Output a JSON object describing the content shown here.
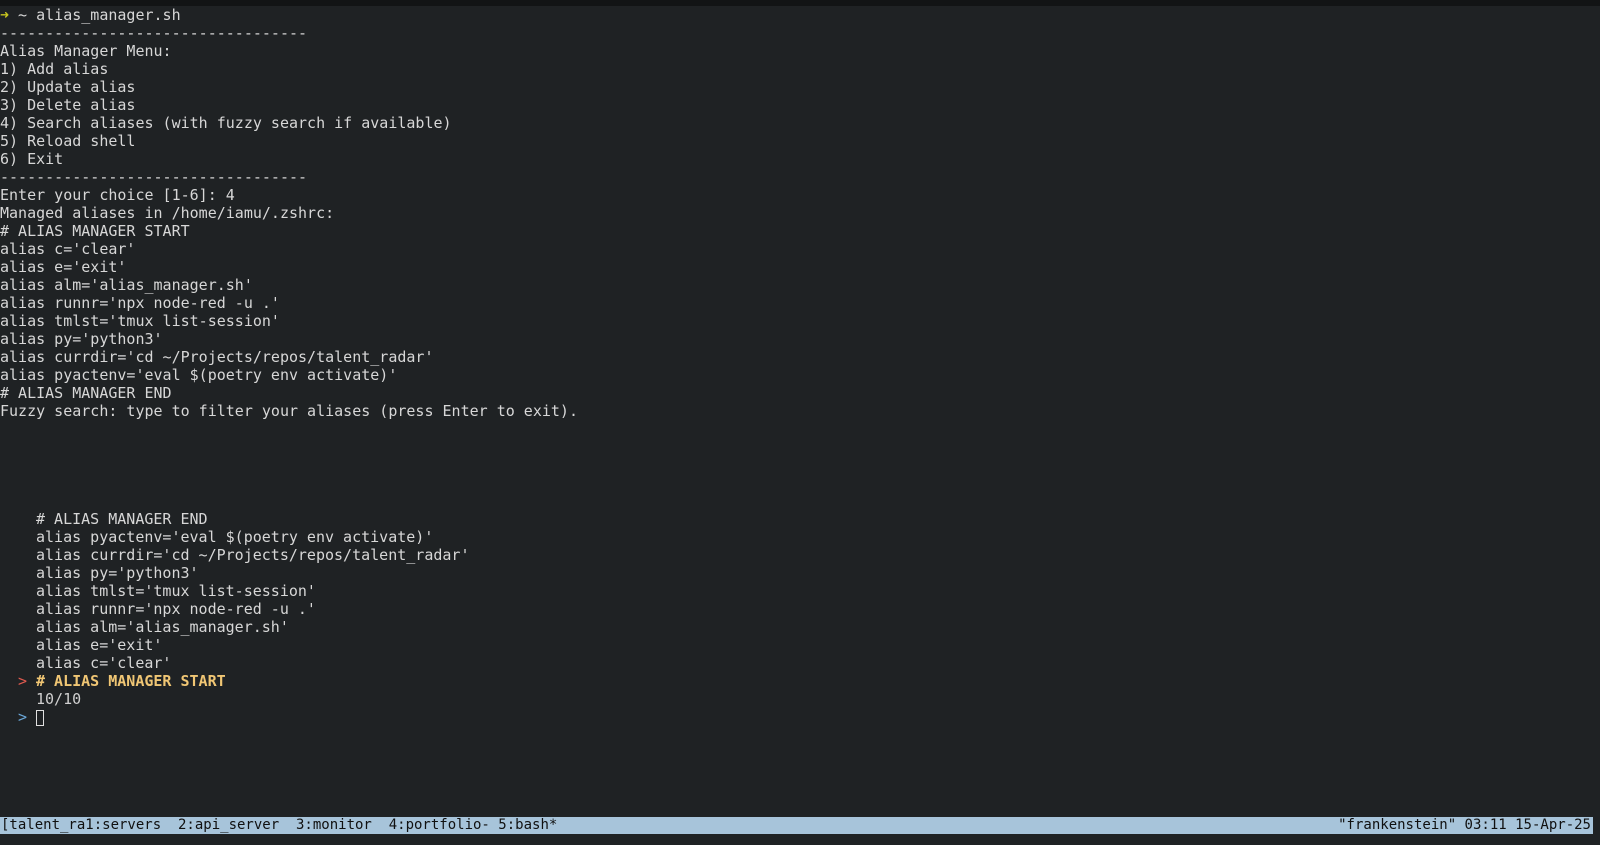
{
  "prompt": {
    "arrow": "➜",
    "command": " ~ alias_manager.sh"
  },
  "output_lines": [
    "----------------------------------",
    "Alias Manager Menu:",
    "1) Add alias",
    "2) Update alias",
    "3) Delete alias",
    "4) Search aliases (with fuzzy search if available)",
    "5) Reload shell",
    "6) Exit",
    "----------------------------------",
    "Enter your choice [1-6]: 4",
    "Managed aliases in /home/iamu/.zshrc:",
    "# ALIAS MANAGER START",
    "alias c='clear'",
    "alias e='exit'",
    "alias alm='alias_manager.sh'",
    "alias runnr='npx node-red -u .'",
    "alias tmlst='tmux list-session'",
    "alias py='python3'",
    "alias currdir='cd ~/Projects/repos/talent_radar'",
    "alias pyactenv='eval $(poetry env activate)'",
    "# ALIAS MANAGER END",
    "Fuzzy search: type to filter your aliases (press Enter to exit)."
  ],
  "fzf": {
    "items": [
      "# ALIAS MANAGER END",
      "alias pyactenv='eval $(poetry env activate)'",
      "alias currdir='cd ~/Projects/repos/talent_radar'",
      "alias py='python3'",
      "alias tmlst='tmux list-session'",
      "alias runnr='npx node-red -u .'",
      "alias alm='alias_manager.sh'",
      "alias e='exit'",
      "alias c='clear'"
    ],
    "selected_pointer": ">",
    "selected_item": "# ALIAS MANAGER START",
    "match_count": "10/10",
    "query_pointer": ">",
    "query": ""
  },
  "statusbar": {
    "left": "[talent_ra1:servers  2:api_server  3:monitor  4:portfolio- 5:bash*",
    "right": "\"frankenstein\" 03:11 15-Apr-25"
  },
  "colors": {
    "background": "#1f2224",
    "foreground": "#d7d7d7",
    "status_bg": "#a7c4da",
    "pointer_red": "#e05a4f",
    "pointer_blue": "#6aa7d8",
    "selected_yellow": "#f0c674",
    "prompt_arrow": "#c7c51f"
  }
}
